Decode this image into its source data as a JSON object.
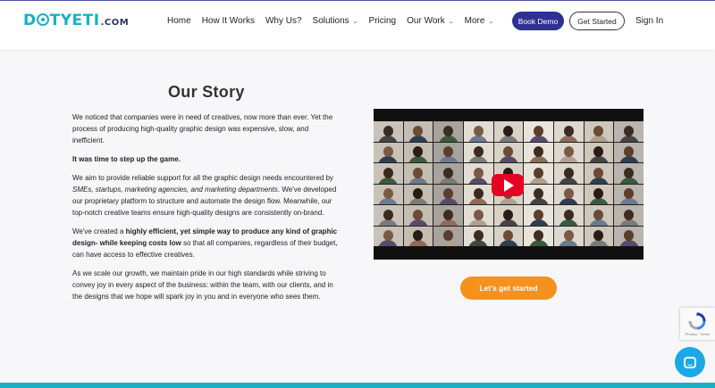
{
  "header": {
    "logo": {
      "part1": "D",
      "part2": "TYETI",
      "suffix": ".COM"
    },
    "nav": [
      {
        "label": "Home",
        "has_dropdown": false
      },
      {
        "label": "How It Works",
        "has_dropdown": false
      },
      {
        "label": "Why Us?",
        "has_dropdown": false
      },
      {
        "label": "Solutions",
        "has_dropdown": true
      },
      {
        "label": "Pricing",
        "has_dropdown": false
      },
      {
        "label": "Our Work",
        "has_dropdown": true
      },
      {
        "label": "More",
        "has_dropdown": true
      }
    ],
    "book_demo": "Book Demo",
    "get_started": "Get Started",
    "sign_in": "Sign In"
  },
  "story": {
    "title": "Our Story",
    "p1": "We noticed that companies were in need of creatives, now more than ever. Yet the process of producing high-quality graphic design was expensive, slow, and inefficient.",
    "p2": "It was time to step up the game.",
    "p3a": "We aim to provide reliable support for all the graphic design needs encountered by ",
    "p3b": "SMEs, startups, marketing agencies, and marketing departments",
    "p3c": ". We've developed our proprietary platform to structure and automate the design flow. Meanwhile, our top-notch creative teams ensure high-quality designs are consistently on-brand.",
    "p4a": "We've created a ",
    "p4b": "highly efficient, yet simple way to produce any kind of graphic design- while keeping costs low",
    "p4c": " so that all companies, regardless of their budget, can have access to effective creatives.",
    "p5": "As we scale our growth, we maintain pride in our high standards while striving to convey joy in every aspect of the business: within the team, with our clients, and in the designs that we hope will spark joy in you and in everyone who sees them."
  },
  "video": {
    "play_icon": "play-icon"
  },
  "cta": "Let's get started",
  "recaptcha": {
    "label": "Privacy - Terms"
  },
  "colors": {
    "brand_teal": "#1ab0c4",
    "brand_navy": "#2e3192",
    "cta_orange": "#f7911e",
    "chat_blue": "#1ca8e8",
    "play_red": "#e60023"
  }
}
